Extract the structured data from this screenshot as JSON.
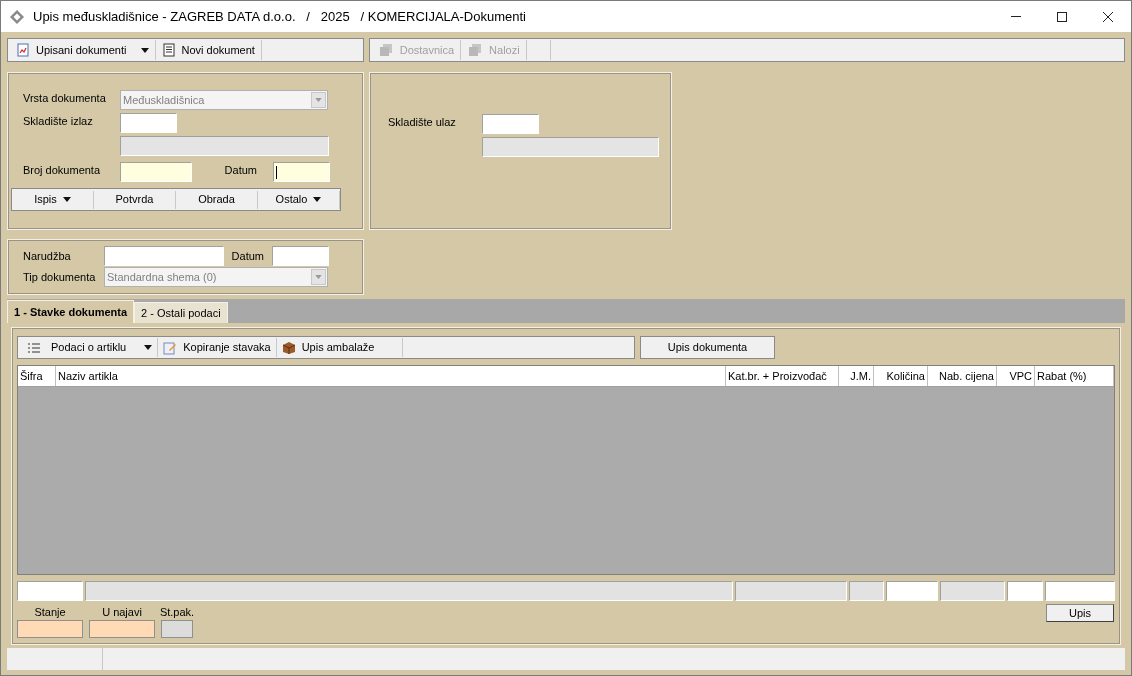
{
  "window": {
    "title": "Upis međuskladišnice - ZAGREB DATA d.o.o.   /   2025   / KOMERCIJALA-Dokumenti"
  },
  "toolbar_left": [
    {
      "label": "Upisani dokumenti",
      "dropdown": true,
      "disabled": false
    },
    {
      "label": "Novi dokument",
      "dropdown": false,
      "disabled": false
    }
  ],
  "toolbar_right": [
    {
      "label": "Dostavnica",
      "dropdown": false,
      "disabled": true
    },
    {
      "label": "Nalozi",
      "dropdown": false,
      "disabled": true
    }
  ],
  "document_panel": {
    "vrsta": {
      "label": "Vrsta dokumenta",
      "value": "Međuskladišnica",
      "disabled": true
    },
    "skladiste_izlaz": {
      "label": "Skladište izlaz"
    },
    "broj": {
      "label": "Broj dokumenta"
    },
    "datum": {
      "label": "Datum",
      "focused": true
    },
    "actions": [
      {
        "label": "Ispis",
        "dropdown": true
      },
      {
        "label": "Potvrda",
        "dropdown": false
      },
      {
        "label": "Obrada",
        "dropdown": false
      },
      {
        "label": "Ostalo",
        "dropdown": true
      }
    ]
  },
  "warehouse_in_panel": {
    "label": "Skladište ulaz"
  },
  "order_panel": {
    "narudzba": {
      "label": "Narudžba"
    },
    "datum": {
      "label": "Datum"
    },
    "tip": {
      "label": "Tip dokumenta",
      "value": "Standardna shema (0)",
      "disabled": true
    }
  },
  "tabs": [
    {
      "label": "1 - Stavke dokumenta",
      "selected": true
    },
    {
      "label": "2 - Ostali podaci",
      "selected": false
    }
  ],
  "items_toolbar": [
    {
      "label": "Podaci o artiklu",
      "dropdown": true
    },
    {
      "label": "Kopiranje stavaka",
      "dropdown": false
    },
    {
      "label": "Upis ambalaže",
      "dropdown": false
    }
  ],
  "upis_dokumenta_button": "Upis dokumenta",
  "table": {
    "columns": [
      "Šifra",
      "Naziv artikla",
      "Kat.br. + Proizvođač",
      "J.M.",
      "Količina",
      "Nab. cijena",
      "VPC",
      "Rabat (%)"
    ]
  },
  "stock": [
    {
      "label": "Stanje",
      "kind": "warm"
    },
    {
      "label": "U najavi",
      "kind": "warm"
    },
    {
      "label": "St.pak.",
      "kind": "readonly"
    }
  ],
  "upis_button": "Upis"
}
